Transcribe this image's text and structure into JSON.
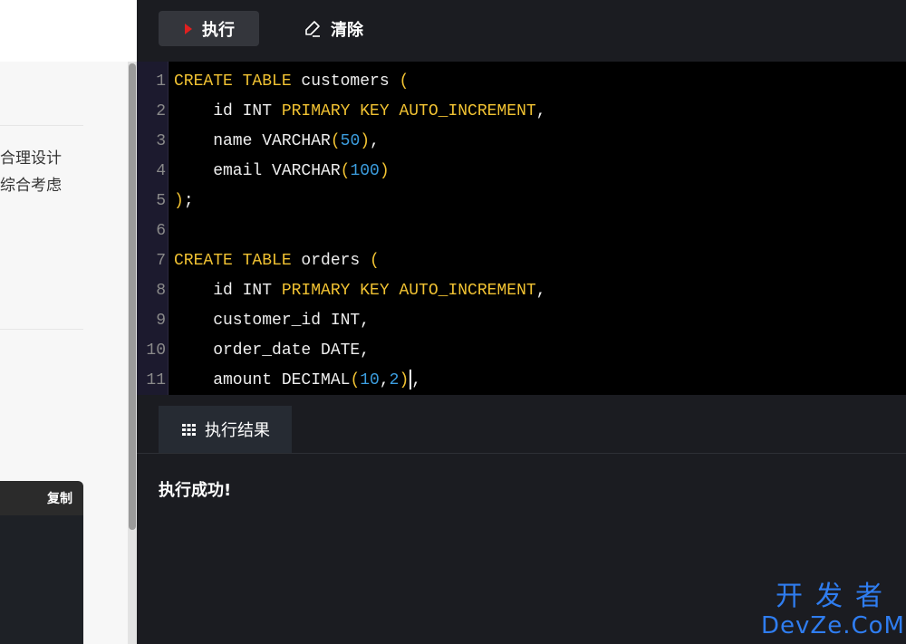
{
  "left_page": {
    "text_line_1": "合理设计",
    "text_line_2": "综合考虑",
    "copy_label": "复制"
  },
  "toolbar": {
    "run_label": "执行",
    "clear_label": "清除"
  },
  "editor": {
    "lines": [
      {
        "n": "1",
        "tokens": [
          {
            "t": "CREATE TABLE",
            "c": "kw"
          },
          {
            "t": " customers ",
            "c": "id"
          },
          {
            "t": "(",
            "c": "kw"
          }
        ]
      },
      {
        "n": "2",
        "tokens": [
          {
            "t": "    id INT ",
            "c": "id"
          },
          {
            "t": "PRIMARY KEY AUTO_INCREMENT",
            "c": "kw"
          },
          {
            "t": ",",
            "c": "id"
          }
        ]
      },
      {
        "n": "3",
        "tokens": [
          {
            "t": "    name VARCHAR",
            "c": "id"
          },
          {
            "t": "(",
            "c": "kw"
          },
          {
            "t": "50",
            "c": "num"
          },
          {
            "t": ")",
            "c": "kw"
          },
          {
            "t": ",",
            "c": "id"
          }
        ]
      },
      {
        "n": "4",
        "tokens": [
          {
            "t": "    email VARCHAR",
            "c": "id"
          },
          {
            "t": "(",
            "c": "kw"
          },
          {
            "t": "100",
            "c": "num"
          },
          {
            "t": ")",
            "c": "kw"
          }
        ]
      },
      {
        "n": "5",
        "tokens": [
          {
            "t": ")",
            "c": "kw"
          },
          {
            "t": ";",
            "c": "id"
          }
        ]
      },
      {
        "n": "6",
        "tokens": []
      },
      {
        "n": "7",
        "tokens": [
          {
            "t": "CREATE TABLE",
            "c": "kw"
          },
          {
            "t": " orders ",
            "c": "id"
          },
          {
            "t": "(",
            "c": "kw"
          }
        ]
      },
      {
        "n": "8",
        "tokens": [
          {
            "t": "    id INT ",
            "c": "id"
          },
          {
            "t": "PRIMARY KEY AUTO_INCREMENT",
            "c": "kw"
          },
          {
            "t": ",",
            "c": "id"
          }
        ]
      },
      {
        "n": "9",
        "tokens": [
          {
            "t": "    customer_id INT,",
            "c": "id"
          }
        ]
      },
      {
        "n": "10",
        "tokens": [
          {
            "t": "    order_date DATE,",
            "c": "id"
          }
        ]
      },
      {
        "n": "11",
        "tokens": [
          {
            "t": "    amount DECIMAL",
            "c": "id"
          },
          {
            "t": "(",
            "c": "kw"
          },
          {
            "t": "10",
            "c": "num"
          },
          {
            "t": ",",
            "c": "id"
          },
          {
            "t": "2",
            "c": "num"
          },
          {
            "t": ")",
            "c": "kw"
          },
          {
            "t": ",",
            "c": "id"
          }
        ]
      }
    ]
  },
  "result": {
    "tab_label": "执行结果",
    "message": "执行成功!"
  },
  "watermark": {
    "cn": "开发者",
    "en": "DevZe.CoM"
  },
  "colors": {
    "keyword": "#f1c232",
    "number": "#3c9ee0",
    "identifier": "#eeeeee",
    "run_icon": "#e02020",
    "watermark": "#2f7df0"
  },
  "icons": {
    "run": "play-icon",
    "clear": "eraser-icon",
    "result_tab": "grid-icon"
  }
}
